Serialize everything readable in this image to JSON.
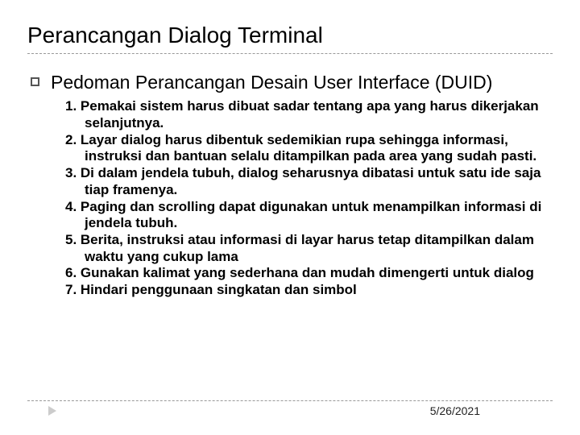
{
  "title": "Perancangan Dialog Terminal",
  "subtitle": "Pedoman Perancangan Desain User Interface (DUID)",
  "items": [
    "1. Pemakai sistem harus dibuat sadar tentang apa yang harus dikerjakan  selanjutnya.",
    "2. Layar dialog harus dibentuk sedemikian rupa sehingga informasi, instruksi dan bantuan selalu ditampilkan pada area yang sudah pasti.",
    "3. Di dalam jendela tubuh, dialog seharusnya dibatasi untuk satu ide saja tiap framenya.",
    "4. Paging dan scrolling dapat digunakan untuk menampilkan informasi di jendela tubuh.",
    "5. Berita, instruksi atau informasi di layar harus tetap ditampilkan  dalam waktu yang cukup lama",
    "6. Gunakan kalimat yang sederhana dan mudah dimengerti untuk dialog",
    "7. Hindari penggunaan singkatan dan simbol"
  ],
  "date": "5/26/2021"
}
